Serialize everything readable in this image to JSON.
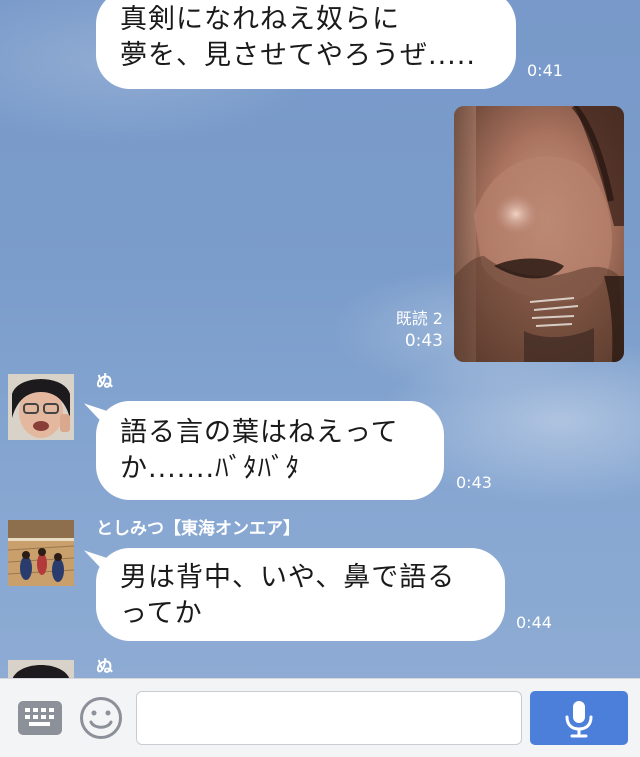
{
  "messages": [
    {
      "direction": "sent",
      "lines": [
        "真剣になれねえ奴らに",
        "夢を、見させてやろうぜ....."
      ],
      "time": "0:41"
    },
    {
      "direction": "sent",
      "kind": "photo",
      "read_status": "既読 2",
      "time": "0:43"
    },
    {
      "direction": "received",
      "sender": "ぬ",
      "lines": [
        "語る言の葉はねえって",
        "か.......ﾊﾞﾀﾊﾞﾀ"
      ],
      "time": "0:43"
    },
    {
      "direction": "received",
      "sender": "としみつ【東海オンエア】",
      "lines": [
        "男は背中、いや、鼻で語る",
        "ってか"
      ],
      "time": "0:44"
    },
    {
      "direction": "received",
      "sender": "ぬ"
    }
  ],
  "input": {
    "placeholder": ""
  },
  "icons": {
    "keyboard": "keyboard-icon",
    "emoji": "smiley-icon",
    "mic": "microphone-icon"
  },
  "colors": {
    "background": "#7b9dcb",
    "bubble": "#ffffff",
    "mic_button": "#4c7fd9"
  }
}
